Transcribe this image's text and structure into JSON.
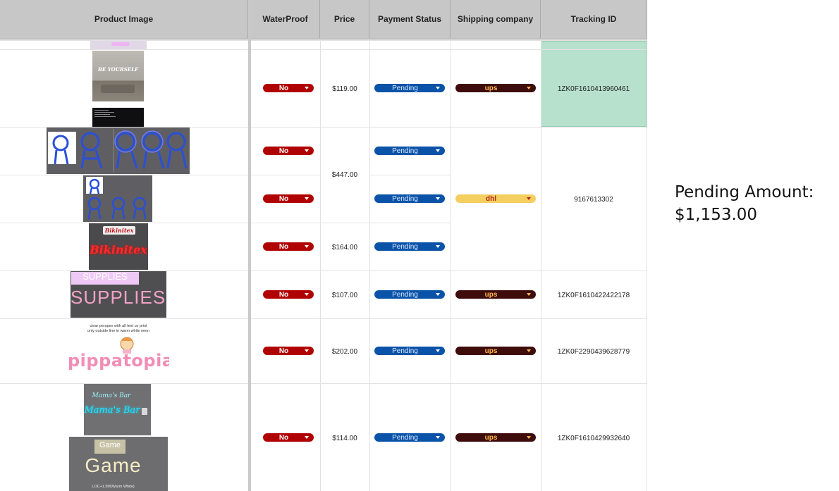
{
  "headers": {
    "image": "Product Image",
    "waterproof": "WaterProof",
    "price": "Price",
    "payment": "Payment Status",
    "shipping": "Shipping company",
    "tracking": "Tracking ID"
  },
  "rows": [
    {
      "waterproof": "No",
      "payment": "Pending"
    },
    {
      "waterproof": "No",
      "payment": "Pending"
    },
    {
      "waterproof": "No",
      "payment": "Pending"
    },
    {
      "waterproof": "No",
      "payment": "Pending"
    },
    {
      "waterproof": "No",
      "payment": "Pending"
    },
    {
      "waterproof": "No",
      "payment": "Pending"
    },
    {
      "waterproof": "No",
      "payment": "Pending"
    }
  ],
  "prices": [
    "$119.00",
    "$447.00",
    "$164.00",
    "$107.00",
    "$202.00",
    "$114.00"
  ],
  "shipping": [
    "ups",
    "dhl",
    "ups",
    "ups",
    "ups"
  ],
  "tracking": [
    "1ZK0F1610413960461",
    "9167613302",
    "1ZK0F1610422422178",
    "1ZK0F2290439628779",
    "1ZK0F1610429932640"
  ],
  "images": {
    "img1": "BE YOURSELF",
    "img4_neon": "Bikinitex",
    "img5_small": "SUPPLIES",
    "img5_big": "SUPPLIES",
    "img6_note1": "clear perspex with all text uv print",
    "img6_note2": "only outside line in warm white neon",
    "img6_brand": "pippatopia",
    "img7_text": "Mama's Bar",
    "img8_small": "Game",
    "img8_big": "Game",
    "img8_caption": "LOC+1.5M(Warm White)"
  },
  "summary": {
    "label": "Pending Amount:",
    "amount": "$1,153.00"
  },
  "colors": {
    "no_chip": "#b10202",
    "pending_chip": "#0a53a8",
    "ups_chip": "#3d0c0b",
    "dhl_chip": "#f4cf5f",
    "highlight_cell": "#b7e1cd",
    "header_bg": "#c7c7c7"
  }
}
